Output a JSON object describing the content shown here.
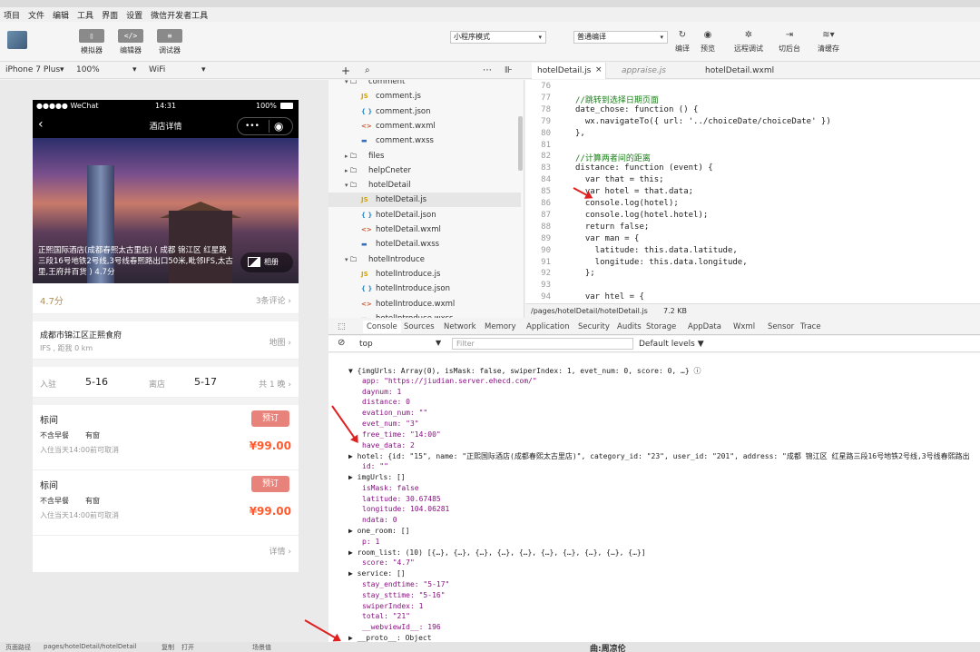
{
  "menu": [
    "项目",
    "文件",
    "编辑",
    "工具",
    "界面",
    "设置",
    "微信开发者工具"
  ],
  "toolbar": {
    "simulator": "模拟器",
    "editor": "编辑器",
    "debugger": "调试器",
    "editor_icon": "</>",
    "debugger_icon": "≡",
    "mode": "小程序模式",
    "compile_mode": "普通编译",
    "compile": "编译",
    "preview": "预览",
    "remote_debug": "远程调试",
    "background": "切后台",
    "clear_cache": "清缓存"
  },
  "sim_bar": {
    "device": "iPhone 7 Plus",
    "zoom": "100%",
    "network": "WiFi"
  },
  "phone": {
    "carrier": "●●●●● WeChat",
    "time": "14:31",
    "battery": "100%",
    "nav_title": "酒店详情",
    "hero_caption": "正熙国际酒店(成都春熙太古里店) ( 成都 锦江区 红星路三段16号地铁2号线,3号线春熙路出口50米,毗邻IFS,太古里,王府井百货 ) 4.7分",
    "photos": "相册",
    "rating": "4.7分",
    "reviews": "3条评论 ›",
    "location_name": "成都市锦江区正熙食府",
    "location_sub": "IFS , 距我 0 km",
    "map": "地图 ›",
    "checkin_label": "入驻",
    "checkin": "5-16",
    "checkout_label": "离店",
    "checkout": "5-17",
    "nights": "共 1 晚 ›",
    "rooms": [
      {
        "name": "标间",
        "breakfast": "不含早餐",
        "window": "有窗",
        "policy": "入住当天14:00前可取消",
        "book": "预订",
        "price": "¥99.00"
      },
      {
        "name": "标间",
        "breakfast": "不含早餐",
        "window": "有窗",
        "policy": "入住当天14:00前可取消",
        "book": "预订",
        "price": "¥99.00"
      }
    ],
    "details": "详情 ›"
  },
  "editor_tabs": [
    "hotelDetail.js",
    "appraise.js",
    "hotelDetail.wxml"
  ],
  "tree": [
    {
      "label": "comment",
      "type": "folder",
      "indent": 1
    },
    {
      "label": "comment.js",
      "type": "js",
      "indent": 2
    },
    {
      "label": "comment.json",
      "type": "json",
      "indent": 2
    },
    {
      "label": "comment.wxml",
      "type": "wxml",
      "indent": 2
    },
    {
      "label": "comment.wxss",
      "type": "wxss",
      "indent": 2
    },
    {
      "label": "files",
      "type": "folder-closed",
      "indent": 1
    },
    {
      "label": "helpCneter",
      "type": "folder-closed",
      "indent": 1
    },
    {
      "label": "hotelDetail",
      "type": "folder",
      "indent": 1
    },
    {
      "label": "hotelDetail.js",
      "type": "js",
      "indent": 2
    },
    {
      "label": "hotelDetail.json",
      "type": "json",
      "indent": 2
    },
    {
      "label": "hotelDetail.wxml",
      "type": "wxml",
      "indent": 2
    },
    {
      "label": "hotelDetail.wxss",
      "type": "wxss",
      "indent": 2
    },
    {
      "label": "hotelIntroduce",
      "type": "folder",
      "indent": 1
    },
    {
      "label": "hotelIntroduce.js",
      "type": "js",
      "indent": 2
    },
    {
      "label": "hotelIntroduce.json",
      "type": "json",
      "indent": 2
    },
    {
      "label": "hotelIntroduce.wxml",
      "type": "wxml",
      "indent": 2
    },
    {
      "label": "hotelIntroduce.wxss",
      "type": "wxss",
      "indent": 2
    }
  ],
  "code": [
    {
      "n": "76",
      "t": ""
    },
    {
      "n": "77",
      "t": "//跳转到选择日期页面",
      "c": "cm"
    },
    {
      "n": "78",
      "t": "date_chose: function () {"
    },
    {
      "n": "79",
      "t": "  wx.navigateTo({ url: '../choiceDate/choiceDate' })"
    },
    {
      "n": "80",
      "t": "},"
    },
    {
      "n": "81",
      "t": ""
    },
    {
      "n": "82",
      "t": "//计算两者间的距离",
      "c": "cm"
    },
    {
      "n": "83",
      "t": "distance: function (event) {"
    },
    {
      "n": "84",
      "t": "  var that = this;"
    },
    {
      "n": "85",
      "t": "  var hotel = that.data;"
    },
    {
      "n": "86",
      "t": "  console.log(hotel);"
    },
    {
      "n": "87",
      "t": "  console.log(hotel.hotel);"
    },
    {
      "n": "88",
      "t": "  return false;"
    },
    {
      "n": "89",
      "t": "  var man = {"
    },
    {
      "n": "90",
      "t": "    latitude: this.data.latitude,"
    },
    {
      "n": "91",
      "t": "    longitude: this.data.longitude,"
    },
    {
      "n": "92",
      "t": "  };"
    },
    {
      "n": "93",
      "t": ""
    },
    {
      "n": "94",
      "t": "  var htel = {"
    }
  ],
  "path_bar": {
    "path": "/pages/hotelDetail/hotelDetail.js",
    "size": "7.2 KB"
  },
  "devtools_tabs": [
    "Console",
    "Sources",
    "Network",
    "Memory",
    "Application",
    "Security",
    "Audits",
    "Storage",
    "AppData",
    "Wxml",
    "Sensor",
    "Trace"
  ],
  "console_filter": {
    "context": "top",
    "placeholder": "Filter",
    "levels": "Default levels ▼"
  },
  "console_lines": [
    {
      "t": "▼ {imgUrls: Array(0), isMask: false, swiperIndex: 1, evet_num: 0, score: 0, …} ⓘ",
      "i": 0
    },
    {
      "t": "app: \"https://jiudian.server.ehecd.com/\"",
      "i": 1
    },
    {
      "t": "daynum: 1",
      "i": 1
    },
    {
      "t": "distance: 0",
      "i": 1
    },
    {
      "t": "evation_num: \"\"",
      "i": 1
    },
    {
      "t": "evet_num: \"3\"",
      "i": 1
    },
    {
      "t": "free_time: \"14:00\"",
      "i": 1
    },
    {
      "t": "have_data: 2",
      "i": 1
    },
    {
      "t": "▶ hotel: {id: \"15\", name: \"正熙国际酒店(成都春熙太古里店)\", category_id: \"23\", user_id: \"201\", address: \"成都 锦江区 红星路三段16号地铁2号线,3号线春熙路出",
      "i": 0
    },
    {
      "t": "id: \"\"",
      "i": 1
    },
    {
      "t": "▶ imgUrls: []",
      "i": 0
    },
    {
      "t": "isMask: false",
      "i": 1
    },
    {
      "t": "latitude: 30.67485",
      "i": 1
    },
    {
      "t": "longitude: 104.06281",
      "i": 1
    },
    {
      "t": "ndata: 0",
      "i": 1
    },
    {
      "t": "▶ one_room: []",
      "i": 0
    },
    {
      "t": "p: 1",
      "i": 1
    },
    {
      "t": "▶ room_list: (10) [{…}, {…}, {…}, {…}, {…}, {…}, {…}, {…}, {…}, {…}]",
      "i": 0
    },
    {
      "t": "score: \"4.7\"",
      "i": 1
    },
    {
      "t": "▶ service: []",
      "i": 0
    },
    {
      "t": "stay_endtime: \"5-17\"",
      "i": 1
    },
    {
      "t": "stay_sttime: \"5-16\"",
      "i": 1
    },
    {
      "t": "swiperIndex: 1",
      "i": 1
    },
    {
      "t": "total: \"21\"",
      "i": 1
    },
    {
      "t": "__webviewId__: 196",
      "i": 1
    },
    {
      "t": "▶ __proto__: Object",
      "i": 0
    },
    {
      "t": "▶ []",
      "i": -1
    }
  ],
  "bottom_bar": {
    "path_label": "页面路径",
    "path": "pages/hotelDetail/hotelDetail",
    "copy": "复制",
    "open": "打开",
    "params": "场景值",
    "watermark": "曲:周凉伦"
  }
}
